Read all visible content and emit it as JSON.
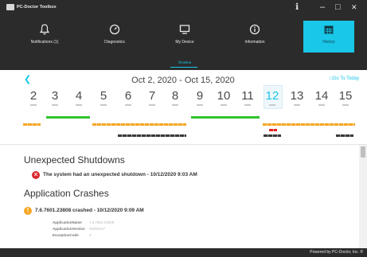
{
  "window": {
    "title": "PC-Doctor Toolbox",
    "controls": {
      "info": "ℹ",
      "minimize": "–",
      "maximize": "□",
      "close": "✕"
    }
  },
  "nav": {
    "tabs": [
      {
        "label": "Notifications (1)",
        "icon": "bell-icon"
      },
      {
        "label": "Diagnostics",
        "icon": "gauge-icon"
      },
      {
        "label": "My Device",
        "icon": "monitor-icon"
      },
      {
        "label": "Information",
        "icon": "info-icon"
      },
      {
        "label": "History",
        "icon": "calendar-icon",
        "selected": true
      }
    ],
    "sub_label": "Timeline"
  },
  "calendar": {
    "prev": "❮",
    "range": "Oct 2, 2020 - Oct 15, 2020",
    "today_label": "Go To Today",
    "days": [
      "2",
      "3",
      "4",
      "5",
      "6",
      "7",
      "8",
      "9",
      "10",
      "11",
      "12",
      "13",
      "14",
      "15"
    ],
    "selected_day": "12",
    "colors": {
      "system": "#2fc42f",
      "warning": "#f5a623",
      "error": "#e02424",
      "other": "#3a3a3a"
    }
  },
  "events": {
    "shutdowns": {
      "title": "Unexpected Shutdowns",
      "items": [
        {
          "text": "The system had an unexpected shutdown - 10/12/2020 9:03 AM",
          "icon": "error-icon"
        }
      ]
    },
    "crashes": {
      "title": "Application Crashes",
      "items": [
        {
          "text": "7.6.7601.23808 crashed - 10/12/2020 9:09 AM",
          "icon": "warning-icon",
          "details": [
            {
              "key": "ApplicationName",
              "value": "7.6.7601.23808"
            },
            {
              "key": "ApplicationVersion",
              "value": "00000017"
            },
            {
              "key": "ExceptionCode",
              "value": "0"
            }
          ]
        }
      ]
    }
  },
  "footer": {
    "text": "Powered by PC-Doctor, Inc. ®"
  }
}
